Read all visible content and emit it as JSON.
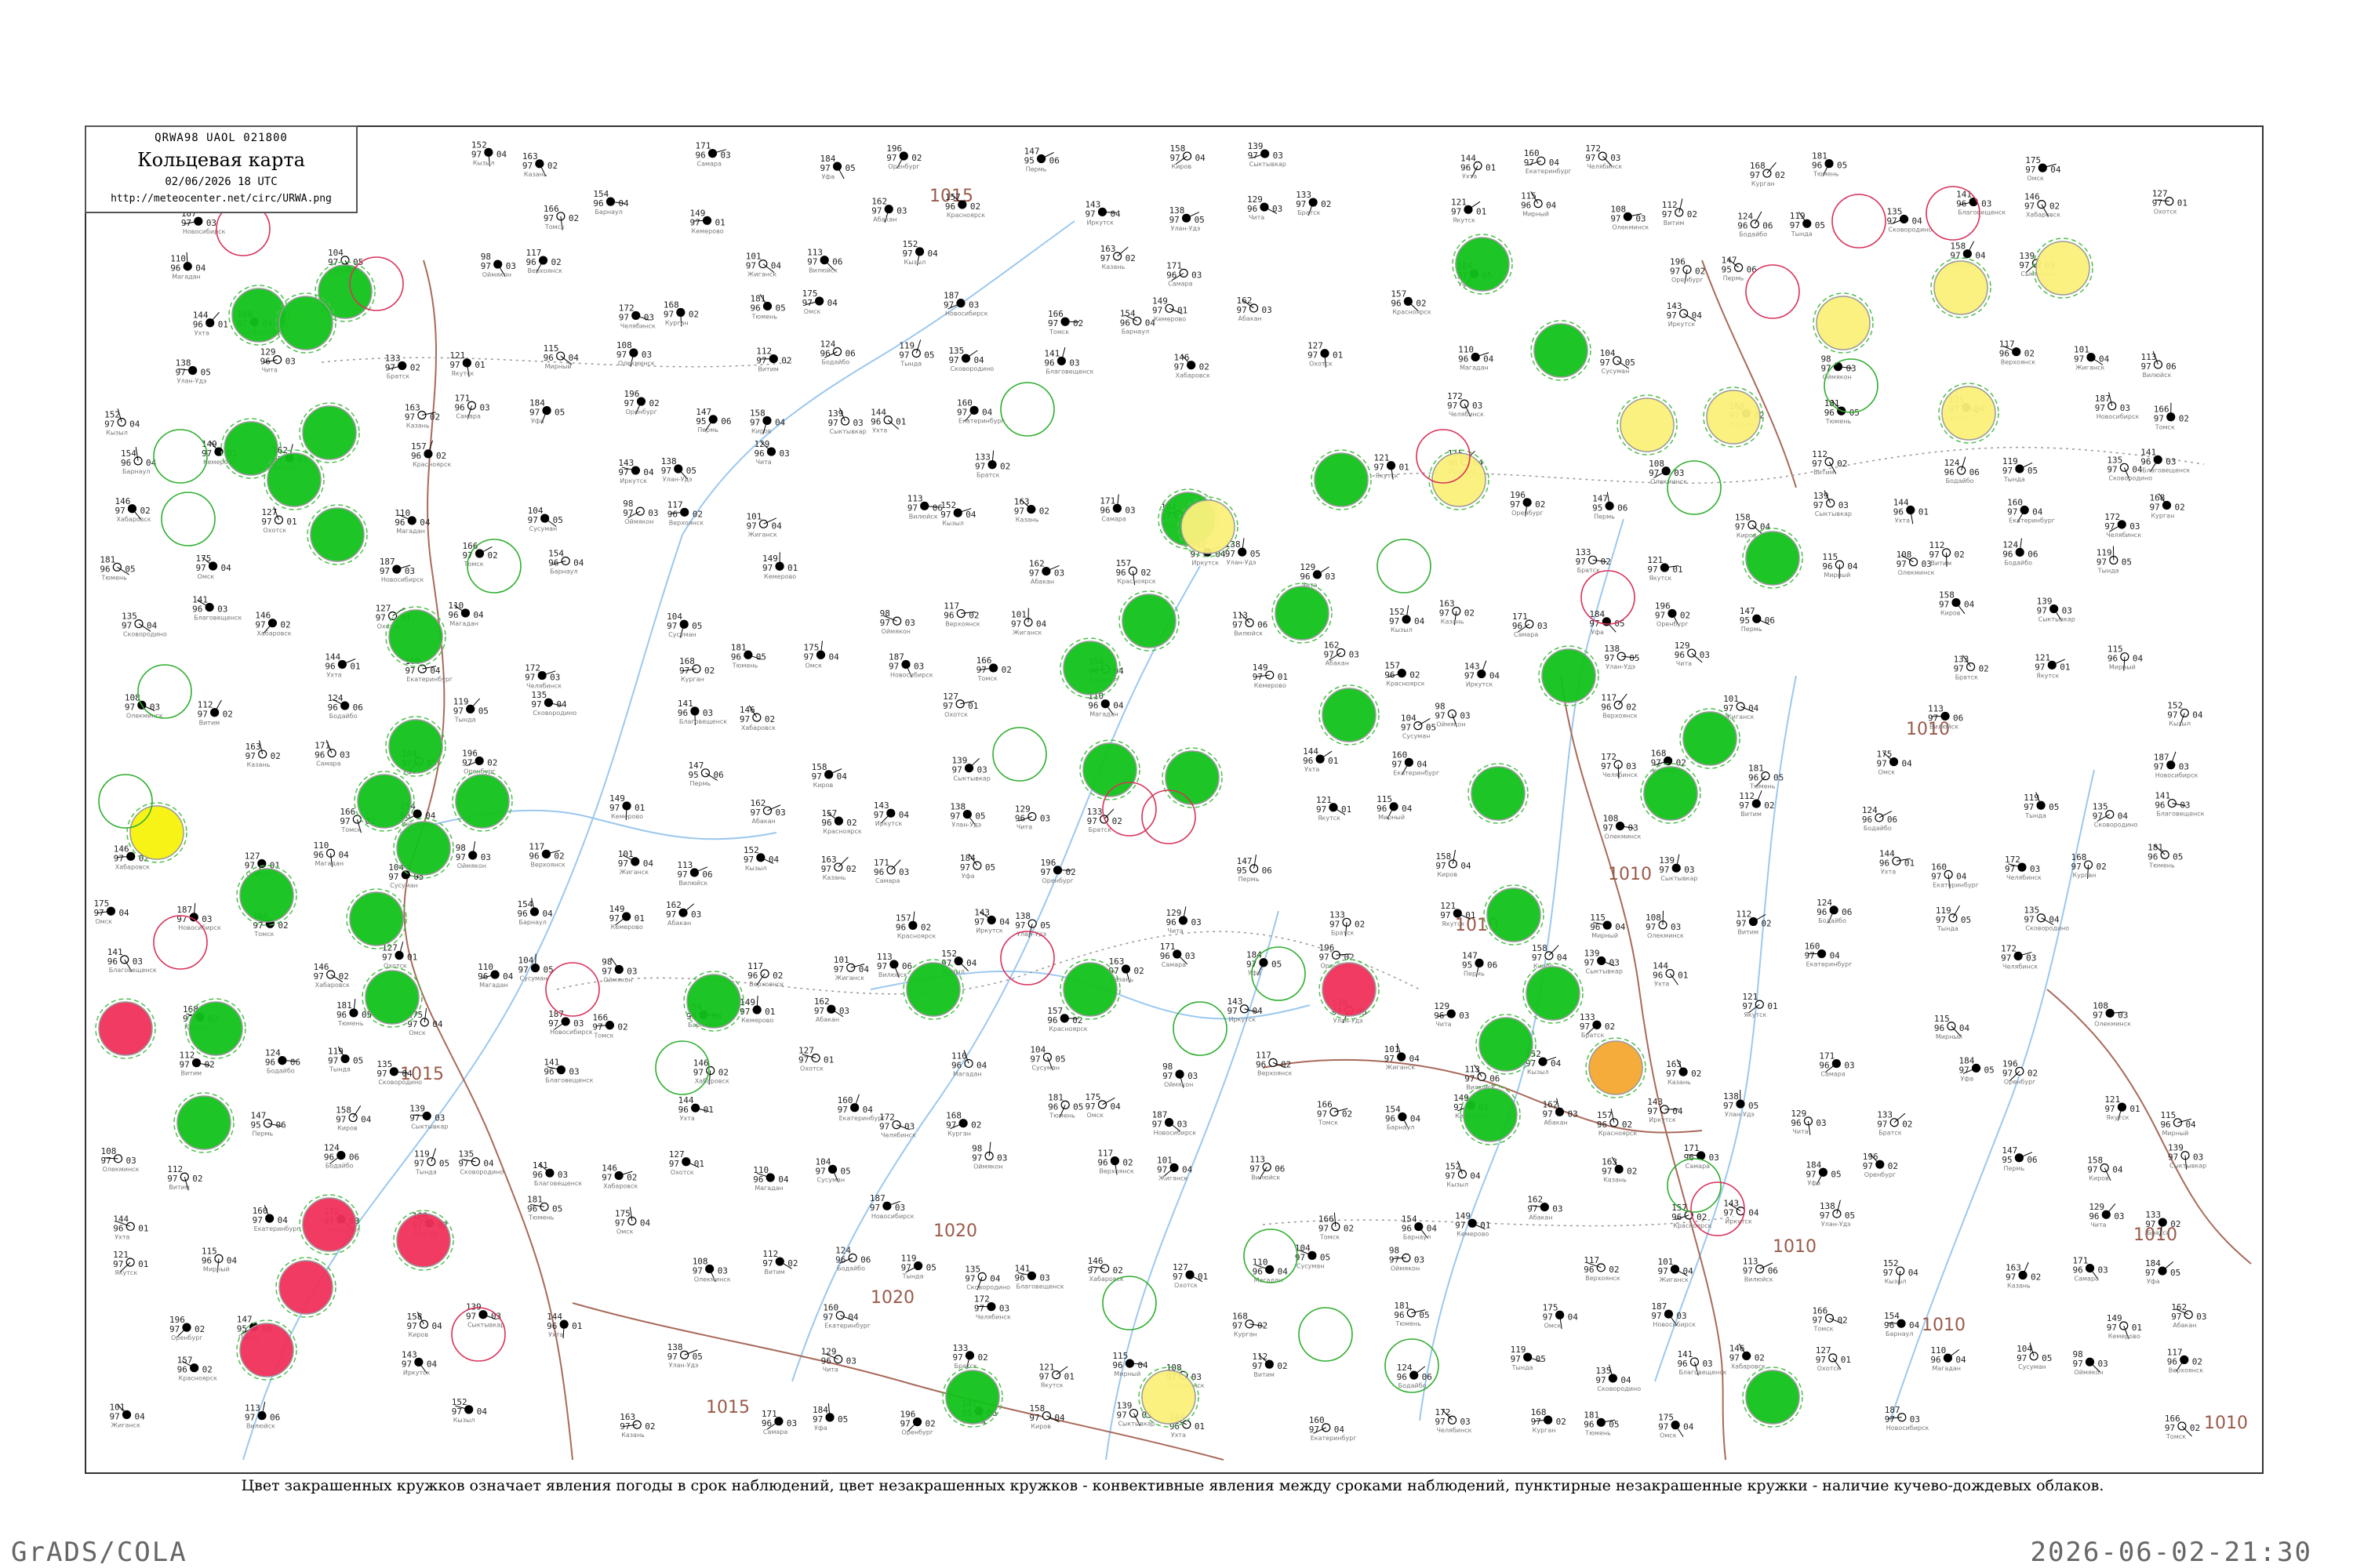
{
  "header": {
    "code": "QRWA98  UAOL  021800",
    "title": "Кольцевая карта",
    "date": "02/06/2026 18 UTC",
    "url": "http://meteocenter.net/circ/URWA.png"
  },
  "legend_note": "Цвет закрашенных кружков означает явления погоды в срок наблюдений, цвет незакрашенных кружков - конвективные явления между сроками наблюдений, пунктирные незакрашенные кружки - наличие кучево-дождевых облаков.",
  "footer": {
    "left": "GrADS/COLA",
    "right": "2026-06-02-21:30"
  },
  "colors": {
    "green_fill": "#12c21a",
    "red_fill": "#f0305a",
    "yellow_fill": "#fbf07a",
    "bright_yellow_fill": "#f8f20a",
    "orange_fill": "#f5a830",
    "isobar": "#a86a5a",
    "river": "#9cc8ee",
    "border": "#999999"
  },
  "isobar_labels": [
    "1015",
    "1010",
    "1010",
    "1010",
    "1010",
    "1010",
    "1015",
    "1015",
    "1020",
    "1020",
    "1010",
    "1010"
  ],
  "stations": [
    {
      "temp": "152",
      "dew": "97",
      "pres": "04",
      "name": "Кызыл"
    },
    {
      "temp": "163",
      "dew": "97",
      "pres": "02",
      "name": "Казань"
    },
    {
      "temp": "171",
      "dew": "96",
      "pres": "03",
      "name": "Самара"
    },
    {
      "temp": "184",
      "dew": "97",
      "pres": "05",
      "name": "Уфа"
    },
    {
      "temp": "196",
      "dew": "97",
      "pres": "02",
      "name": "Оренбург"
    },
    {
      "temp": "147",
      "dew": "95",
      "pres": "06",
      "name": "Пермь"
    },
    {
      "temp": "158",
      "dew": "97",
      "pres": "04",
      "name": "Киров"
    },
    {
      "temp": "139",
      "dew": "97",
      "pres": "03",
      "name": "Сыктывкар"
    },
    {
      "temp": "144",
      "dew": "96",
      "pres": "01",
      "name": "Ухта"
    },
    {
      "temp": "160",
      "dew": "97",
      "pres": "04",
      "name": "Екатеринбург"
    },
    {
      "temp": "172",
      "dew": "97",
      "pres": "03",
      "name": "Челябинск"
    },
    {
      "temp": "168",
      "dew": "97",
      "pres": "02",
      "name": "Курган"
    },
    {
      "temp": "181",
      "dew": "96",
      "pres": "05",
      "name": "Тюмень"
    },
    {
      "temp": "175",
      "dew": "97",
      "pres": "04",
      "name": "Омск"
    },
    {
      "temp": "187",
      "dew": "97",
      "pres": "03",
      "name": "Новосибирск"
    },
    {
      "temp": "166",
      "dew": "97",
      "pres": "02",
      "name": "Томск"
    },
    {
      "temp": "154",
      "dew": "96",
      "pres": "04",
      "name": "Барнаул"
    },
    {
      "temp": "149",
      "dew": "97",
      "pres": "01",
      "name": "Кемерово"
    },
    {
      "temp": "162",
      "dew": "97",
      "pres": "03",
      "name": "Абакан"
    },
    {
      "temp": "157",
      "dew": "96",
      "pres": "02",
      "name": "Красноярск"
    },
    {
      "temp": "143",
      "dew": "97",
      "pres": "04",
      "name": "Иркутск"
    },
    {
      "temp": "138",
      "dew": "97",
      "pres": "05",
      "name": "Улан-Удэ"
    },
    {
      "temp": "129",
      "dew": "96",
      "pres": "03",
      "name": "Чита"
    },
    {
      "temp": "133",
      "dew": "97",
      "pres": "02",
      "name": "Братск"
    },
    {
      "temp": "121",
      "dew": "97",
      "pres": "01",
      "name": "Якутск"
    },
    {
      "temp": "115",
      "dew": "96",
      "pres": "04",
      "name": "Мирный"
    },
    {
      "temp": "108",
      "dew": "97",
      "pres": "03",
      "name": "Олекминск"
    },
    {
      "temp": "112",
      "dew": "97",
      "pres": "02",
      "name": "Витим"
    },
    {
      "temp": "124",
      "dew": "96",
      "pres": "06",
      "name": "Бодайбо"
    },
    {
      "temp": "119",
      "dew": "97",
      "pres": "05",
      "name": "Тында"
    },
    {
      "temp": "135",
      "dew": "97",
      "pres": "04",
      "name": "Сковородино"
    },
    {
      "temp": "141",
      "dew": "96",
      "pres": "03",
      "name": "Благовещенск"
    },
    {
      "temp": "146",
      "dew": "97",
      "pres": "02",
      "name": "Хабаровск"
    },
    {
      "temp": "127",
      "dew": "97",
      "pres": "01",
      "name": "Охотск"
    },
    {
      "temp": "110",
      "dew": "96",
      "pres": "04",
      "name": "Магадан"
    },
    {
      "temp": "104",
      "dew": "97",
      "pres": "05",
      "name": "Сусуман"
    },
    {
      "temp": "98",
      "dew": "97",
      "pres": "03",
      "name": "Оймякон"
    },
    {
      "temp": "117",
      "dew": "96",
      "pres": "02",
      "name": "Верхоянск"
    },
    {
      "temp": "101",
      "dew": "97",
      "pres": "04",
      "name": "Жиганск"
    },
    {
      "temp": "113",
      "dew": "97",
      "pres": "06",
      "name": "Вилюйск"
    }
  ]
}
